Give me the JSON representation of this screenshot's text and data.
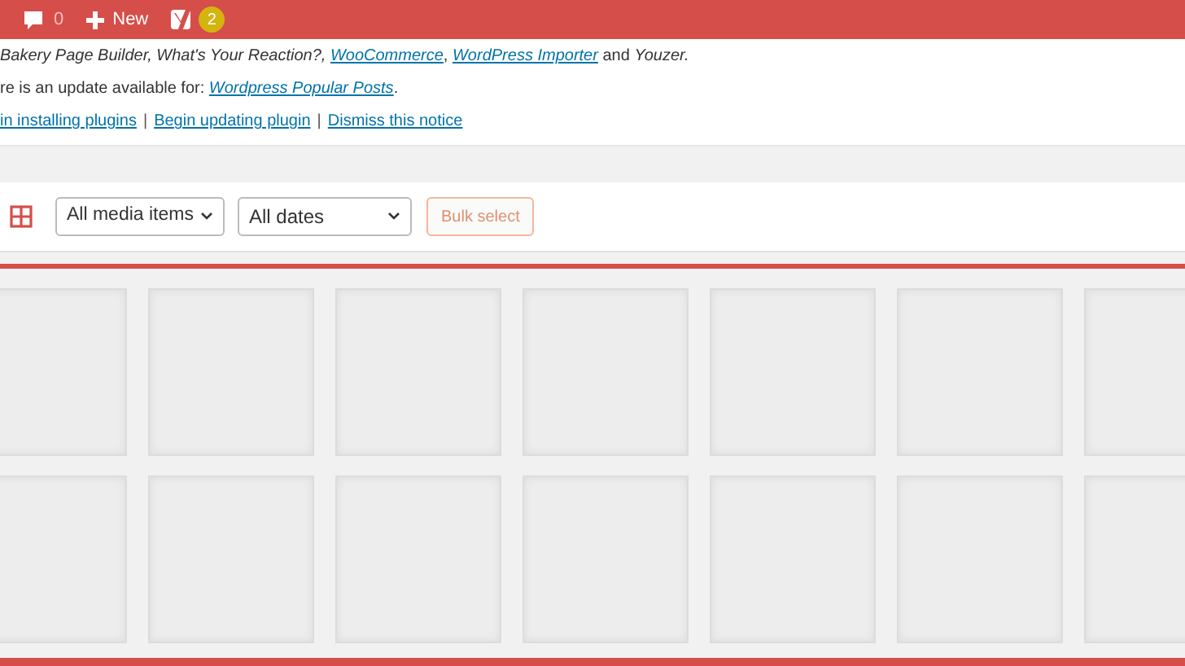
{
  "admin_bar": {
    "comments_count": "0",
    "new_label": "New",
    "seo_badge": "2"
  },
  "notice": {
    "line_1": [
      {
        "kind": "italic",
        "text": "Bakery Page Builder, What's Your Reaction?, "
      },
      {
        "kind": "link",
        "text": "WooCommerce"
      },
      {
        "kind": "plain",
        "text": ", "
      },
      {
        "kind": "link",
        "text": "WordPress Importer"
      },
      {
        "kind": "plain",
        "text": " and "
      },
      {
        "kind": "italic",
        "text": "Youzer."
      }
    ],
    "line_2": [
      {
        "kind": "plain",
        "text": "re is an update available for: "
      },
      {
        "kind": "link",
        "text": "Wordpress Popular Posts"
      },
      {
        "kind": "plain",
        "text": "."
      }
    ],
    "actions": [
      "in installing plugins",
      "Begin updating plugin",
      "Dismiss this notice"
    ],
    "action_separator": "|"
  },
  "toolbar": {
    "media_filter": "All media items",
    "date_filter": "All dates",
    "bulk_button": "Bulk select"
  }
}
